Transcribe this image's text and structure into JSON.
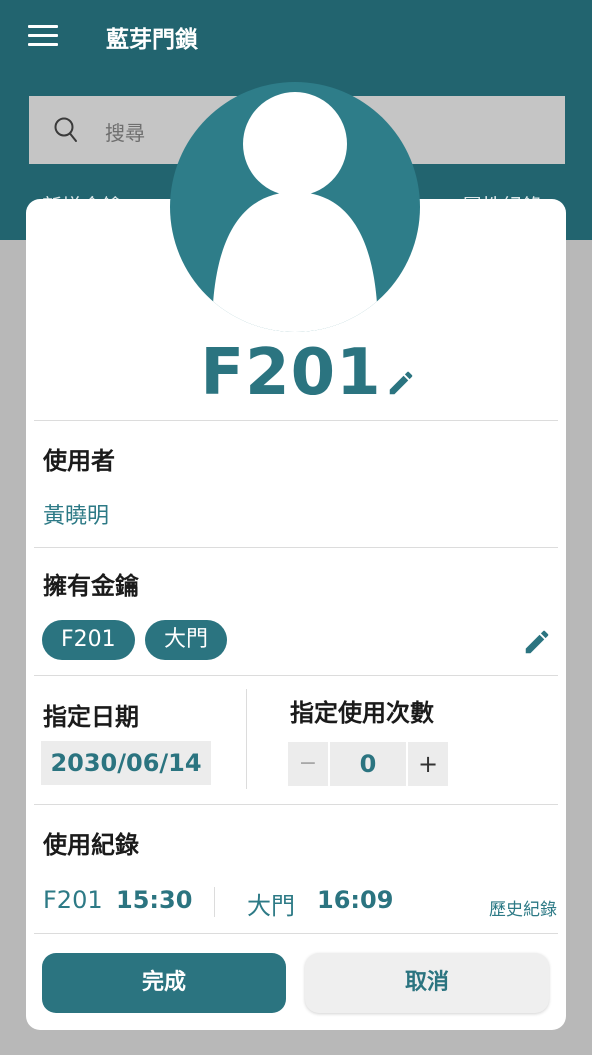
{
  "app": {
    "title": "藍芽門鎖"
  },
  "search": {
    "placeholder": "搜尋"
  },
  "tabs": {
    "left": "新增金鑰",
    "right": "屬性紀錄"
  },
  "device": {
    "name": "F201"
  },
  "user_section": {
    "label": "使用者",
    "value": "黃曉明"
  },
  "keys_section": {
    "label": "擁有金鑰",
    "chips": [
      "F201",
      "大門"
    ]
  },
  "date_section": {
    "label": "指定日期",
    "value": "2030/06/14"
  },
  "count_section": {
    "label": "指定使用次數",
    "minus": "−",
    "value": "0",
    "plus": "+"
  },
  "log_section": {
    "label": "使用紀錄",
    "entries": [
      {
        "key": "F201",
        "time": "15:30"
      },
      {
        "key": "大門",
        "time": "16:09"
      }
    ],
    "history_link": "歷史紀錄"
  },
  "actions": {
    "done": "完成",
    "cancel": "取消"
  },
  "colors": {
    "primary": "#2b7480",
    "appbar": "#22646f",
    "overlay": "#b8b8b8"
  }
}
